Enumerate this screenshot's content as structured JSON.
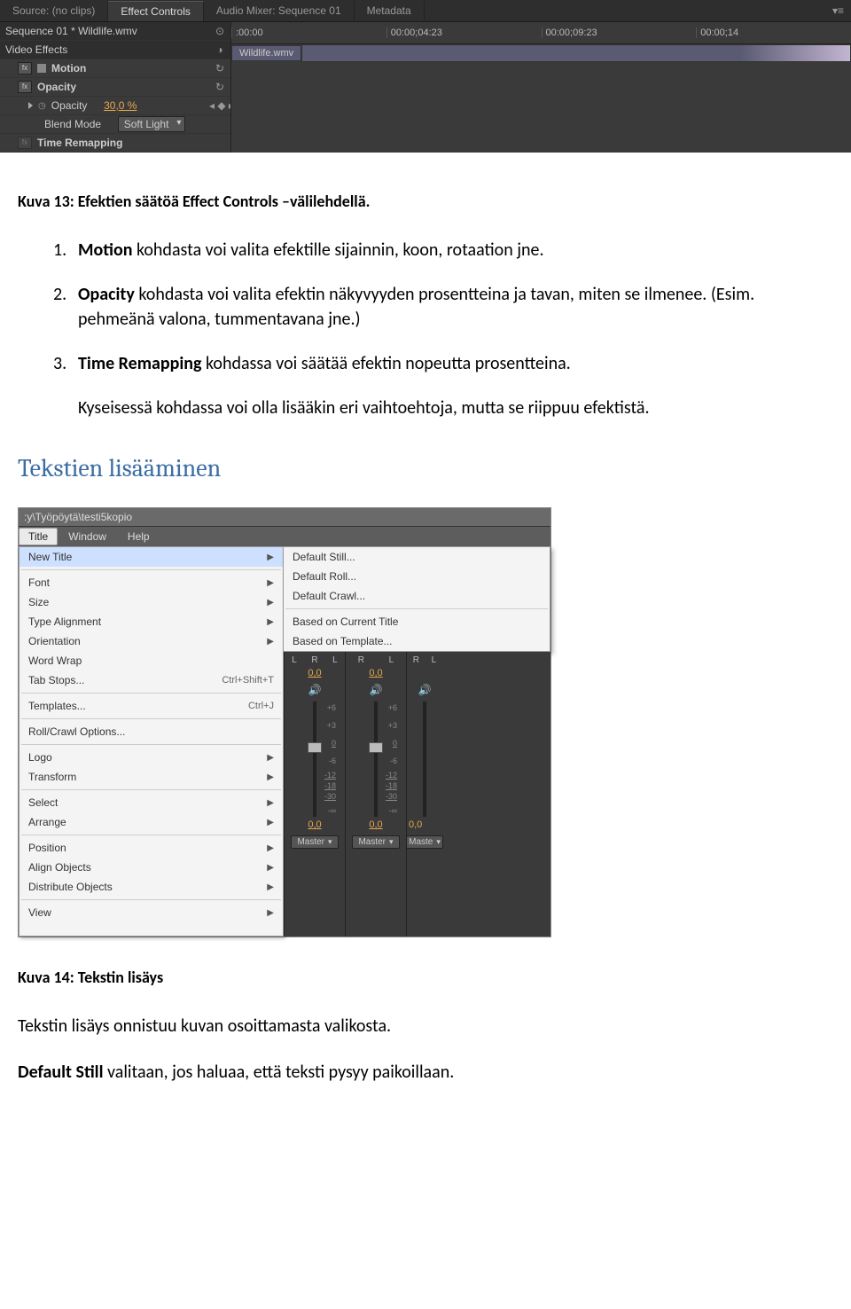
{
  "panel": {
    "tabs": [
      "Source: (no clips)",
      "Effect Controls",
      "Audio Mixer: Sequence 01",
      "Metadata"
    ],
    "active_tab_index": 1,
    "sequence_label": "Sequence 01 * Wildlife.wmv",
    "video_effects": "Video Effects",
    "motion": "Motion",
    "opacity_group": "Opacity",
    "opacity_prop": "Opacity",
    "opacity_value": "30,0 %",
    "blend_mode_label": "Blend Mode",
    "blend_mode_value": "Soft Light",
    "time_remapping": "Time Remapping",
    "timeline_marks": [
      ":00:00",
      "00:00;04:23",
      "00:00;09:23",
      "00:00;14"
    ],
    "clip_name": "Wildlife.wmv"
  },
  "doc": {
    "caption1": "Kuva 13: Efektien säätöä Effect Controls –välilehdellä.",
    "list": [
      {
        "n": "1.",
        "bold": "Motion",
        "text": " kohdasta voi valita efektille sijainnin, koon, rotaation jne."
      },
      {
        "n": "2.",
        "bold": "Opacity",
        "text": " kohdasta voi valita efektin näkyvyyden prosentteina ja tavan, miten se ilmenee. (Esim. pehmeänä valona, tummentavana jne.)"
      },
      {
        "n": "3.",
        "bold": "Time Remapping",
        "text": " kohdassa voi säätää efektin nopeutta prosentteina."
      }
    ],
    "subpara": "Kyseisessä kohdassa voi olla lisääkin eri vaihtoehtoja, mutta se riippuu efektistä.",
    "h2": "Tekstien lisääminen",
    "caption2": "Kuva 14: Tekstin lisäys",
    "para_after": "Tekstin lisäys onnistuu kuvan osoittamasta valikosta.",
    "para_last_bold": "Default Still",
    "para_last_rest": " valitaan, jos haluaa, että teksti pysyy paikoillaan."
  },
  "menu": {
    "path": ":y\\Työpöytä\\testi5kopio",
    "menubar": [
      "Title",
      "Window",
      "Help"
    ],
    "active_menu_index": 0,
    "items": [
      {
        "label": "New Title",
        "sub": true,
        "hover": true
      },
      {
        "sep": true
      },
      {
        "label": "Font",
        "sub": true
      },
      {
        "label": "Size",
        "sub": true
      },
      {
        "label": "Type Alignment",
        "sub": true
      },
      {
        "label": "Orientation",
        "sub": true
      },
      {
        "label": "Word Wrap"
      },
      {
        "label": "Tab Stops...",
        "shortcut": "Ctrl+Shift+T"
      },
      {
        "sep": true
      },
      {
        "label": "Templates...",
        "shortcut": "Ctrl+J"
      },
      {
        "sep": true
      },
      {
        "label": "Roll/Crawl Options..."
      },
      {
        "sep": true
      },
      {
        "label": "Logo",
        "sub": true
      },
      {
        "label": "Transform",
        "sub": true
      },
      {
        "sep": true
      },
      {
        "label": "Select",
        "sub": true
      },
      {
        "label": "Arrange",
        "sub": true
      },
      {
        "sep": true
      },
      {
        "label": "Position",
        "sub": true
      },
      {
        "label": "Align Objects",
        "sub": true
      },
      {
        "label": "Distribute Objects",
        "sub": true
      },
      {
        "sep": true
      },
      {
        "label": "View",
        "sub": true
      }
    ],
    "submenu": [
      {
        "label": "Default Still..."
      },
      {
        "label": "Default Roll..."
      },
      {
        "label": "Default Crawl..."
      },
      {
        "sep": true
      },
      {
        "label": "Based on Current Title"
      },
      {
        "label": "Based on Template..."
      }
    ]
  },
  "mixer": {
    "lr": [
      "L",
      "R"
    ],
    "val": "0,0",
    "ticks": [
      "+6",
      "+3",
      "0",
      "-6",
      "-12",
      "-18",
      "-30",
      "-∞"
    ],
    "master": "Master"
  }
}
